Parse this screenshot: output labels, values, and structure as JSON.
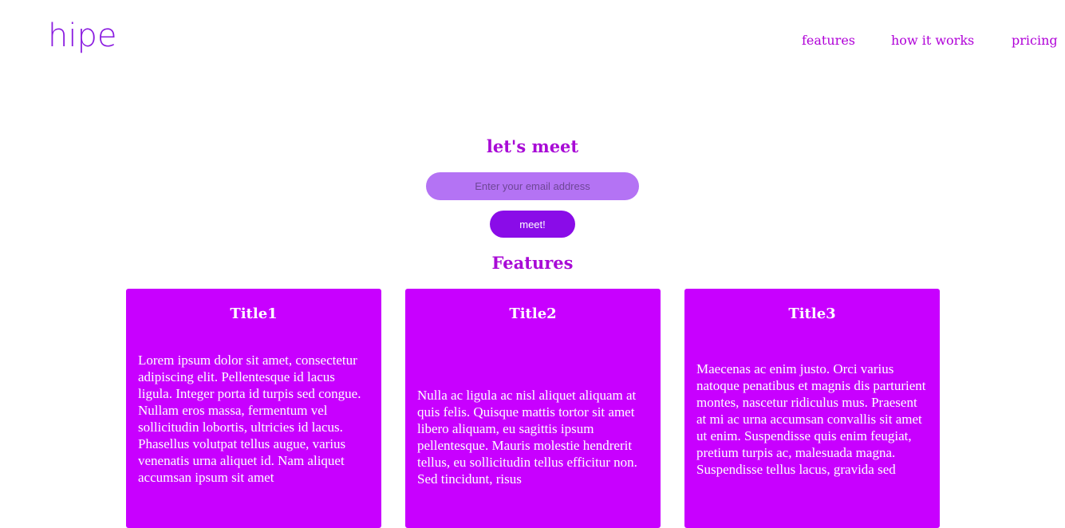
{
  "header": {
    "logo": "hipe",
    "nav": {
      "features": "features",
      "how_it_works": "how it works",
      "pricing": "pricing"
    }
  },
  "hero": {
    "title": "let's meet",
    "email_placeholder": "Enter your email address",
    "email_value": "",
    "button_label": "meet!"
  },
  "features": {
    "title": "Features",
    "cards": [
      {
        "title": "Title1",
        "body": "Lorem ipsum dolor sit amet, consectetur adipiscing elit. Pellentesque id lacus ligula. Integer porta id turpis sed congue. Nullam eros massa, fermentum vel sollicitudin lobortis, ultricies id lacus. Phasellus volutpat tellus augue, varius venenatis urna aliquet id. Nam aliquet accumsan ipsum sit amet"
      },
      {
        "title": "Title2",
        "body": "Nulla ac ligula ac nisl aliquet aliquam at quis felis. Quisque mattis tortor sit amet libero aliquam, eu sagittis ipsum pellentesque. Mauris molestie hendrerit tellus, eu sollicitudin tellus efficitur non. Sed tincidunt, risus"
      },
      {
        "title": "Title3",
        "body": "Maecenas ac enim justo. Orci varius natoque penatibus et magnis dis parturient montes, nascetur ridiculus mus. Praesent at mi ac urna accumsan convallis sit amet ut enim. Suspendisse quis enim feugiat, pretium turpis ac, malesuada magna. Suspendisse tellus lacus, gravida sed"
      }
    ]
  },
  "colors": {
    "accent": "#b000d8",
    "card_bg": "#c800ff",
    "input_bg": "#b473f4",
    "button_bg": "#8a0ce8"
  }
}
